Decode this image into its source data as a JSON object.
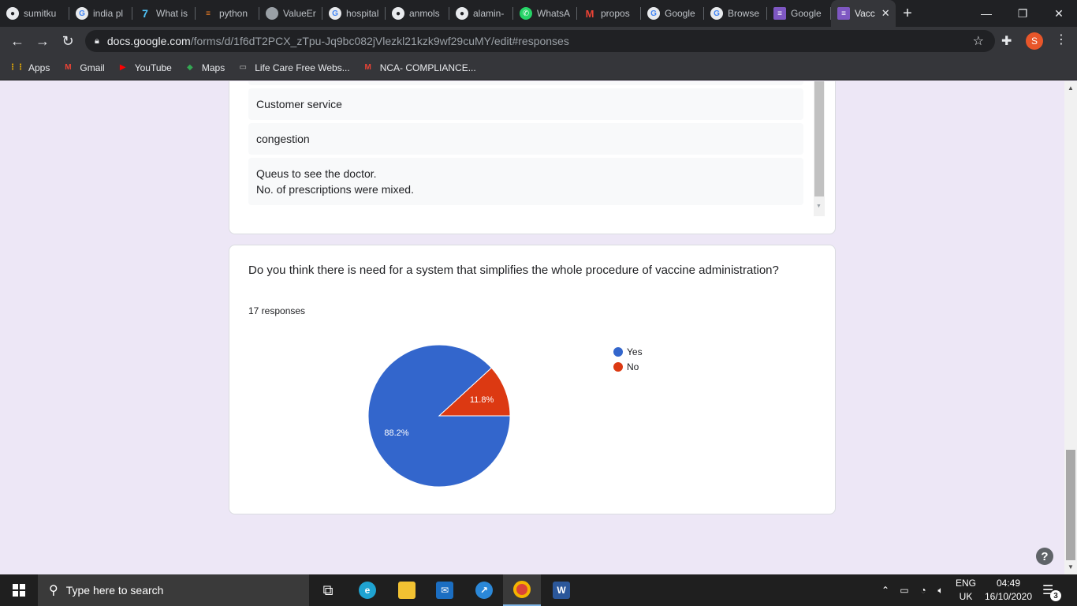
{
  "browser": {
    "tabs": [
      {
        "label": "sumitku",
        "icon": "github-icon",
        "glyph": "●",
        "cls": "gh",
        "width": 88
      },
      {
        "label": "india pl",
        "icon": "google-icon",
        "glyph": "G",
        "cls": "g",
        "width": 80
      },
      {
        "label": "What is",
        "icon": "web-icon",
        "glyph": "7",
        "cls": "wi",
        "width": 80
      },
      {
        "label": "python",
        "icon": "stackoverflow-icon",
        "glyph": "≡",
        "cls": "so",
        "width": 81
      },
      {
        "label": "ValueEr",
        "icon": "globe-icon",
        "glyph": "",
        "cls": "ve",
        "width": 80
      },
      {
        "label": "hospital",
        "icon": "google-icon",
        "glyph": "G",
        "cls": "g",
        "width": 80
      },
      {
        "label": "anmols",
        "icon": "github-icon",
        "glyph": "●",
        "cls": "gh",
        "width": 81
      },
      {
        "label": "alamin-",
        "icon": "github-icon",
        "glyph": "●",
        "cls": "gh",
        "width": 81
      },
      {
        "label": "WhatsA",
        "icon": "whatsapp-icon",
        "glyph": "✆",
        "cls": "wa",
        "width": 81
      },
      {
        "label": "propos",
        "icon": "gmail-icon",
        "glyph": "M",
        "cls": "gm",
        "width": 81
      },
      {
        "label": "Google",
        "icon": "google-icon",
        "glyph": "G",
        "cls": "g",
        "width": 80
      },
      {
        "label": "Browse",
        "icon": "google-icon",
        "glyph": "G",
        "cls": "g",
        "width": 80
      },
      {
        "label": "Google",
        "icon": "google-forms-icon",
        "glyph": "≡",
        "cls": "forms",
        "width": 81
      },
      {
        "label": "Vacc",
        "icon": "google-forms-icon",
        "glyph": "≡",
        "cls": "forms",
        "width": 82,
        "active": true
      }
    ],
    "url_host": "docs.google.com",
    "url_path": "/forms/d/1f6dT2PCX_zTpu-Jq9bc082jVlezkl21kzk9wf29cuMY/edit#responses",
    "profile_initial": "S",
    "bookmarks": [
      {
        "label": "Apps",
        "icon": "apps-grid-icon",
        "glyph": "⋮⋮",
        "color": "#f4b400"
      },
      {
        "label": "Gmail",
        "icon": "gmail-icon",
        "glyph": "M",
        "color": "#ea4335"
      },
      {
        "label": "YouTube",
        "icon": "youtube-icon",
        "glyph": "▶",
        "color": "#ff0000"
      },
      {
        "label": "Maps",
        "icon": "maps-pin-icon",
        "glyph": "◆",
        "color": "#34a853"
      },
      {
        "label": "Life Care Free Webs...",
        "icon": "bookmark-site-icon",
        "glyph": "▭",
        "color": "#bdbdbd"
      },
      {
        "label": "NCA- COMPLIANCE...",
        "icon": "gmail-icon",
        "glyph": "M",
        "color": "#ea4335"
      }
    ]
  },
  "form": {
    "previous_responses": [
      {
        "lines": [
          "Customer service"
        ]
      },
      {
        "lines": [
          "congestion"
        ]
      },
      {
        "lines": [
          "Queus to see the doctor.",
          "No. of prescriptions were mixed."
        ]
      }
    ],
    "question": {
      "title": "Do you think there is need for a system that simplifies the whole procedure of vaccine administration?",
      "response_count": "17 responses"
    }
  },
  "chart_data": {
    "type": "pie",
    "title": "",
    "slices": [
      {
        "label": "Yes",
        "value": 88.2,
        "color": "#3366cc",
        "label_text": "88.2%"
      },
      {
        "label": "No",
        "value": 11.8,
        "color": "#dc3912",
        "label_text": "11.8%"
      }
    ],
    "legend_position": "right"
  },
  "taskbar": {
    "search_placeholder": "Type here to search",
    "language_line1": "ENG",
    "language_line2": "UK",
    "time": "04:49",
    "date": "16/10/2020",
    "notification_count": "3"
  }
}
